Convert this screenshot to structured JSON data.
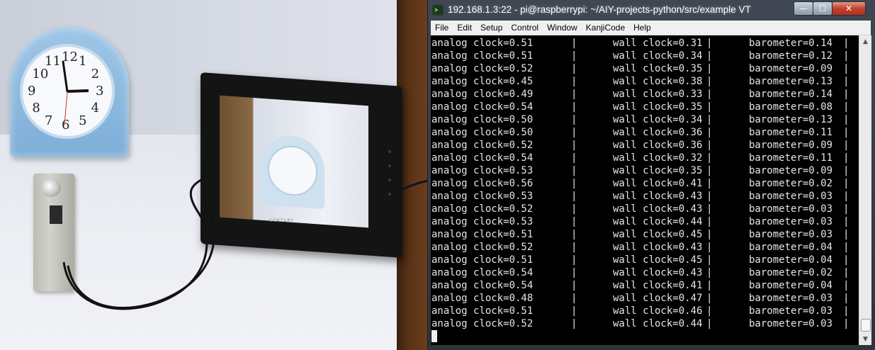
{
  "window": {
    "title": "192.168.1.3:22 - pi@raspberrypi: ~/AIY-projects-python/src/example VT",
    "buttons": {
      "minimize": "—",
      "maximize": "☐",
      "close": "✕"
    }
  },
  "menu": [
    "File",
    "Edit",
    "Setup",
    "Control",
    "Window",
    "KanjiCode",
    "Help"
  ],
  "terminal": {
    "lines": [
      {
        "analog": "analog clock=0.51",
        "wall": "wall clock=0.31",
        "baro": "barometer=0.14"
      },
      {
        "analog": "analog clock=0.51",
        "wall": "wall clock=0.34",
        "baro": "barometer=0.12"
      },
      {
        "analog": "analog clock=0.52",
        "wall": "wall clock=0.35",
        "baro": "barometer=0.09"
      },
      {
        "analog": "analog clock=0.45",
        "wall": "wall clock=0.38",
        "baro": "barometer=0.13"
      },
      {
        "analog": "analog clock=0.49",
        "wall": "wall clock=0.33",
        "baro": "barometer=0.14"
      },
      {
        "analog": "analog clock=0.54",
        "wall": "wall clock=0.35",
        "baro": "barometer=0.08"
      },
      {
        "analog": "analog clock=0.50",
        "wall": "wall clock=0.34",
        "baro": "barometer=0.13"
      },
      {
        "analog": "analog clock=0.50",
        "wall": "wall clock=0.36",
        "baro": "barometer=0.11"
      },
      {
        "analog": "analog clock=0.52",
        "wall": "wall clock=0.36",
        "baro": "barometer=0.09"
      },
      {
        "analog": "analog clock=0.54",
        "wall": "wall clock=0.32",
        "baro": "barometer=0.11"
      },
      {
        "analog": "analog clock=0.53",
        "wall": "wall clock=0.35",
        "baro": "barometer=0.09"
      },
      {
        "analog": "analog clock=0.56",
        "wall": "wall clock=0.41",
        "baro": "barometer=0.02"
      },
      {
        "analog": "analog clock=0.53",
        "wall": "wall clock=0.43",
        "baro": "barometer=0.03"
      },
      {
        "analog": "analog clock=0.52",
        "wall": "wall clock=0.43",
        "baro": "barometer=0.03"
      },
      {
        "analog": "analog clock=0.53",
        "wall": "wall clock=0.44",
        "baro": "barometer=0.03"
      },
      {
        "analog": "analog clock=0.51",
        "wall": "wall clock=0.45",
        "baro": "barometer=0.03"
      },
      {
        "analog": "analog clock=0.52",
        "wall": "wall clock=0.43",
        "baro": "barometer=0.04"
      },
      {
        "analog": "analog clock=0.51",
        "wall": "wall clock=0.45",
        "baro": "barometer=0.04"
      },
      {
        "analog": "analog clock=0.54",
        "wall": "wall clock=0.43",
        "baro": "barometer=0.02"
      },
      {
        "analog": "analog clock=0.54",
        "wall": "wall clock=0.41",
        "baro": "barometer=0.04"
      },
      {
        "analog": "analog clock=0.48",
        "wall": "wall clock=0.47",
        "baro": "barometer=0.03"
      },
      {
        "analog": "analog clock=0.51",
        "wall": "wall clock=0.46",
        "baro": "barometer=0.03"
      },
      {
        "analog": "analog clock=0.52",
        "wall": "wall clock=0.44",
        "baro": "barometer=0.03"
      }
    ],
    "separator": "|"
  },
  "photo": {
    "clock_numbers": [
      "12",
      "1",
      "2",
      "3",
      "4",
      "5",
      "6",
      "7",
      "8",
      "9",
      "10",
      "11"
    ],
    "monitor_brand": "CENTURY"
  },
  "colors": {
    "terminal_bg": "#000000",
    "terminal_fg": "#e6e6e6",
    "titlebar": "#3f4752",
    "close_button": "#c2412a"
  },
  "icons": {
    "title": "terminal-app-icon",
    "scroll_up": "arrow-up-icon",
    "scroll_down": "arrow-down-icon"
  }
}
